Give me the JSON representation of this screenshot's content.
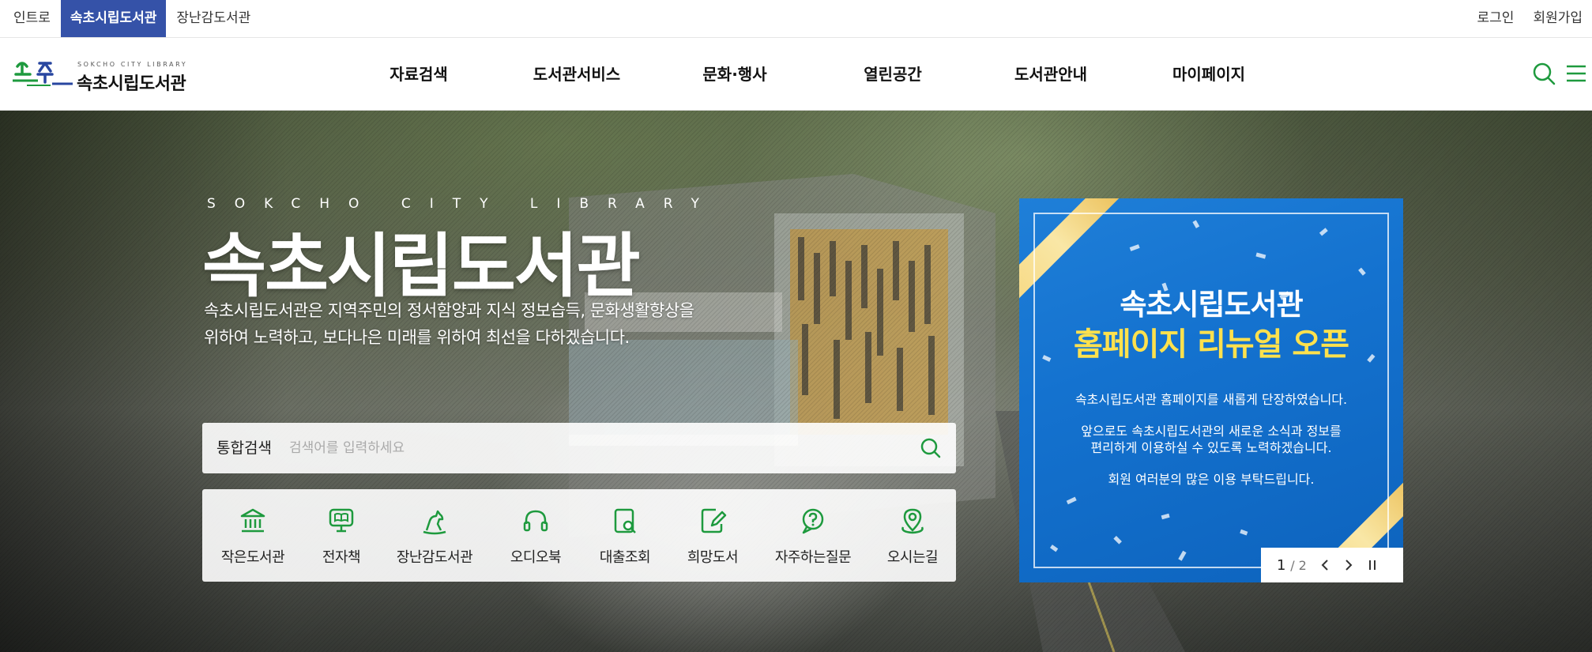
{
  "topbar": {
    "site_tabs": [
      "인트로",
      "속초시립도서관",
      "장난감도서관"
    ],
    "user_links": [
      "로그인",
      "회원가입"
    ]
  },
  "header": {
    "logo_sub": "SOKCHO CITY LIBRARY",
    "logo_name": "속초시립도서관",
    "menu": [
      "자료검색",
      "도서관서비스",
      "문화·행사",
      "열린공간",
      "도서관안내",
      "마이페이지"
    ],
    "icons": [
      "search-icon",
      "hamburger-menu-icon"
    ]
  },
  "hero": {
    "eng_title": "SOKCHO CITY LIBRARY",
    "title": "속초시립도서관",
    "desc_line1": "속초시립도서관은 지역주민의 정서함양과 지식 정보습득, 문화생활향상을",
    "desc_line2": "위하여 노력하고, 보다나은 미래를 위하여 최선을 다하겠습니다."
  },
  "search": {
    "label": "통합검색",
    "placeholder": "검색어를 입력하세요"
  },
  "quick_menu": [
    {
      "label": "작은도서관",
      "icon": "library-building-icon"
    },
    {
      "label": "전자책",
      "icon": "ebook-icon"
    },
    {
      "label": "장난감도서관",
      "icon": "toy-horse-icon"
    },
    {
      "label": "오디오북",
      "icon": "headphones-icon"
    },
    {
      "label": "대출조회",
      "icon": "loan-search-icon"
    },
    {
      "label": "희망도서",
      "icon": "book-request-icon"
    },
    {
      "label": "자주하는질문",
      "icon": "faq-icon"
    },
    {
      "label": "오시는길",
      "icon": "location-pin-icon"
    }
  ],
  "popup": {
    "title1": "속초시립도서관",
    "title2": "홈페이지 리뉴얼 오픈",
    "para1": "속초시립도서관 홈페이지를 새롭게 단장하였습니다.",
    "para2_line1": "앞으로도 속초시립도서관의 새로운 소식과 정보를",
    "para2_line2": "편리하게 이용하실 수 있도록 노력하겠습니다.",
    "para3": "회원 여러분의 많은 이용 부탁드립니다.",
    "page_current": "1",
    "page_total": "/ 2"
  },
  "colors": {
    "brand_blue": "#3552a8",
    "accent_green": "#1e9a3e",
    "popup_blue": "#1472cf",
    "popup_yellow": "#ffe14d"
  }
}
